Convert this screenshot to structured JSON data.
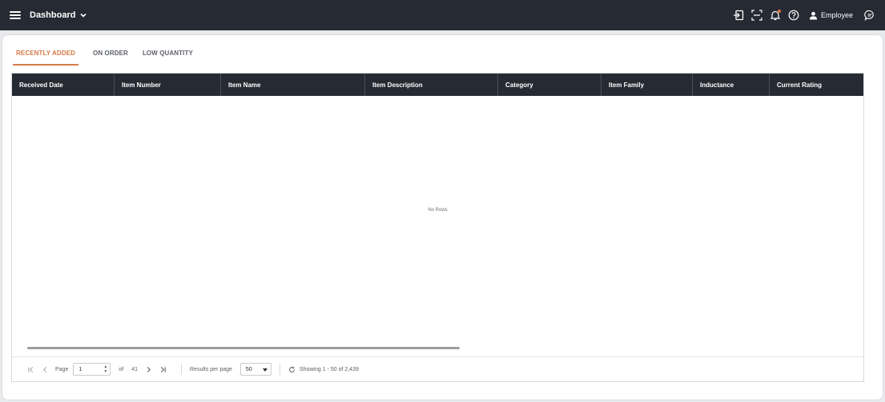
{
  "topbar": {
    "title": "Dashboard",
    "user_label": "Employee",
    "icons": [
      "menu-icon",
      "chevron-down-icon",
      "login-icon",
      "scan-icon",
      "bell-icon",
      "help-icon",
      "user-icon",
      "chat-icon"
    ],
    "notification_dot_color": "#e8733d"
  },
  "tabs": [
    {
      "label": "RECENTLY ADDED",
      "active": true
    },
    {
      "label": "ON ORDER",
      "active": false
    },
    {
      "label": "LOW QUANTITY",
      "active": false
    }
  ],
  "accent_color": "#d57a47",
  "header_bg": "#262a33",
  "table": {
    "columns": [
      "Received Date",
      "Item Number",
      "Item Name",
      "Item Description",
      "Category",
      "Item Family",
      "Inductance",
      "Current Rating"
    ],
    "empty_message": "No Rows"
  },
  "pager": {
    "page_label": "Page",
    "page_value": "1",
    "of_label": "of",
    "total_pages": "41",
    "rpp_label": "Results per page",
    "rpp_value": "50",
    "showing": "Showing 1 - 50 of 2,439"
  }
}
